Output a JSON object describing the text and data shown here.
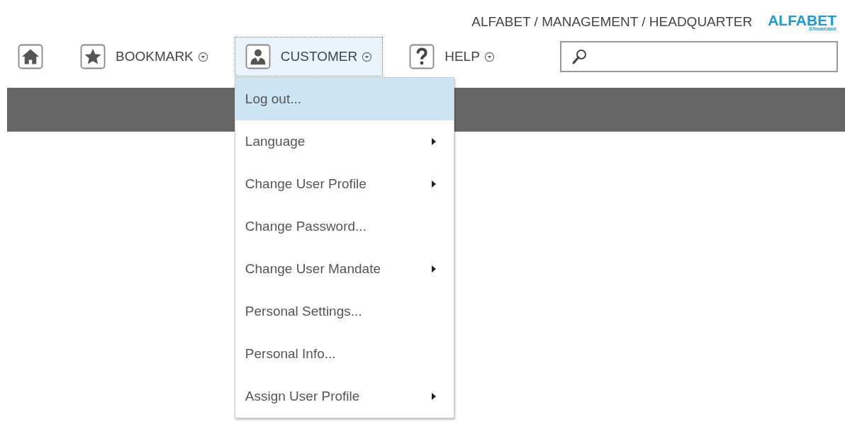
{
  "breadcrumb": "ALFABET / MANAGEMENT / HEADQUARTER",
  "logo": {
    "name": "ALFABET",
    "tagline": "Showcase"
  },
  "nav": [
    {
      "kind": "home",
      "selected": false
    },
    {
      "kind": "bookmark",
      "label": "BOOKMARK",
      "selected": false
    },
    {
      "kind": "customer",
      "label": "CUSTOMER",
      "selected": true
    },
    {
      "kind": "help",
      "label": "HELP",
      "selected": false
    }
  ],
  "menu": [
    {
      "label": "Log out...",
      "selected": true,
      "submenu": false
    },
    {
      "label": "Language",
      "selected": false,
      "submenu": true
    },
    {
      "label": "Change User Profile",
      "selected": false,
      "submenu": true
    },
    {
      "label": "Change Password...",
      "selected": false,
      "submenu": false
    },
    {
      "label": "Change User Mandate",
      "selected": false,
      "submenu": true
    },
    {
      "label": "Personal Settings...",
      "selected": false,
      "submenu": false
    },
    {
      "label": "Personal Info...",
      "selected": false,
      "submenu": false
    },
    {
      "label": "Assign User Profile",
      "selected": false,
      "submenu": true
    }
  ]
}
